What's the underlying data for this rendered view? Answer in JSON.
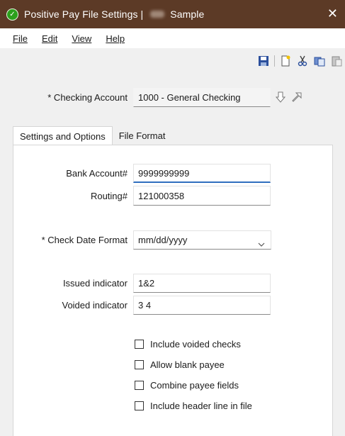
{
  "window": {
    "title": "Positive Pay File Settings |",
    "company": "Sample",
    "accent_color": "#5c3a26",
    "app_icon_color": "#2ca01c",
    "icon": "app-logo-icon"
  },
  "menu": {
    "items": [
      {
        "label": "File"
      },
      {
        "label": "Edit"
      },
      {
        "label": "View"
      },
      {
        "label": "Help"
      }
    ]
  },
  "toolbar": {
    "icons": [
      "save-icon",
      "new-document-icon",
      "cut-icon",
      "copy-icon",
      "paste-icon"
    ]
  },
  "account": {
    "label": "* Checking Account",
    "value": "1000 - General Checking",
    "nav_icons": [
      "arrow-down-icon",
      "arrow-up-right-icon"
    ]
  },
  "tabs": [
    {
      "label": "Settings and Options",
      "active": true
    },
    {
      "label": "File Format",
      "active": false
    }
  ],
  "form": {
    "bank_account": {
      "label": "Bank Account#",
      "value": "9999999999"
    },
    "routing": {
      "label": "Routing#",
      "value": "121000358"
    },
    "check_date_format": {
      "label": "* Check Date Format",
      "value": "mm/dd/yyyy"
    },
    "issued_indicator": {
      "label": "Issued indicator",
      "value": "1&2"
    },
    "voided_indicator": {
      "label": "Voided indicator",
      "value": "3 4"
    }
  },
  "options": [
    {
      "label": "Include voided checks",
      "checked": false
    },
    {
      "label": "Allow blank payee",
      "checked": false
    },
    {
      "label": "Combine payee fields",
      "checked": false
    },
    {
      "label": "Include header line in file",
      "checked": false
    }
  ]
}
